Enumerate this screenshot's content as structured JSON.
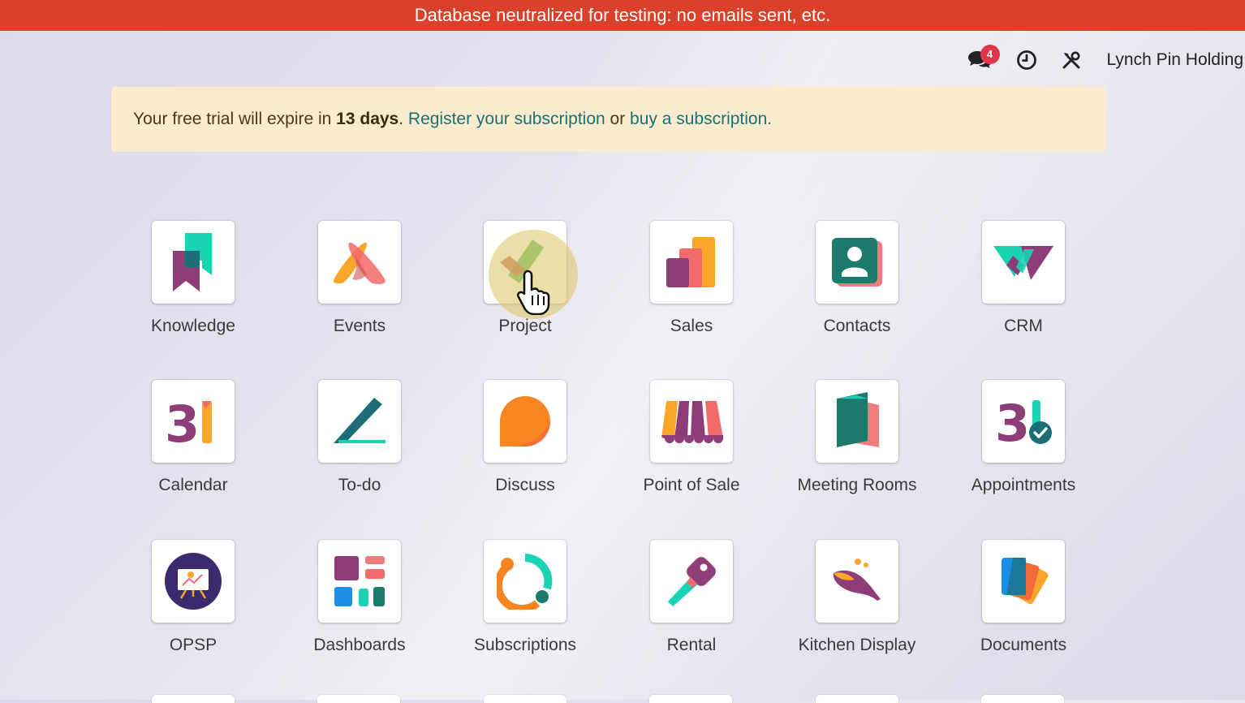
{
  "banner": {
    "text": "Database neutralized for testing: no emails sent, etc."
  },
  "topbar": {
    "chat_badge": "4",
    "icons": [
      "chat-icon",
      "clock-icon",
      "tools-icon"
    ],
    "company": "Lynch Pin Holding"
  },
  "trial": {
    "prefix": "Your free trial will expire in ",
    "days": "13 days",
    "dot": ". ",
    "register": "Register your subscription",
    "or": " or ",
    "buy": "buy a subscription."
  },
  "apps": [
    {
      "label": "Knowledge"
    },
    {
      "label": "Events"
    },
    {
      "label": "Project"
    },
    {
      "label": "Sales"
    },
    {
      "label": "Contacts"
    },
    {
      "label": "CRM"
    },
    {
      "label": "Calendar"
    },
    {
      "label": "To-do"
    },
    {
      "label": "Discuss"
    },
    {
      "label": "Point of Sale"
    },
    {
      "label": "Meeting Rooms"
    },
    {
      "label": "Appointments"
    },
    {
      "label": "OPSP"
    },
    {
      "label": "Dashboards"
    },
    {
      "label": "Subscriptions"
    },
    {
      "label": "Rental"
    },
    {
      "label": "Kitchen Display"
    },
    {
      "label": "Documents"
    }
  ],
  "colors": {
    "banner": "#d9412b",
    "trial_bg": "#fbecce",
    "link": "#17707a",
    "badge": "#e0384a"
  }
}
